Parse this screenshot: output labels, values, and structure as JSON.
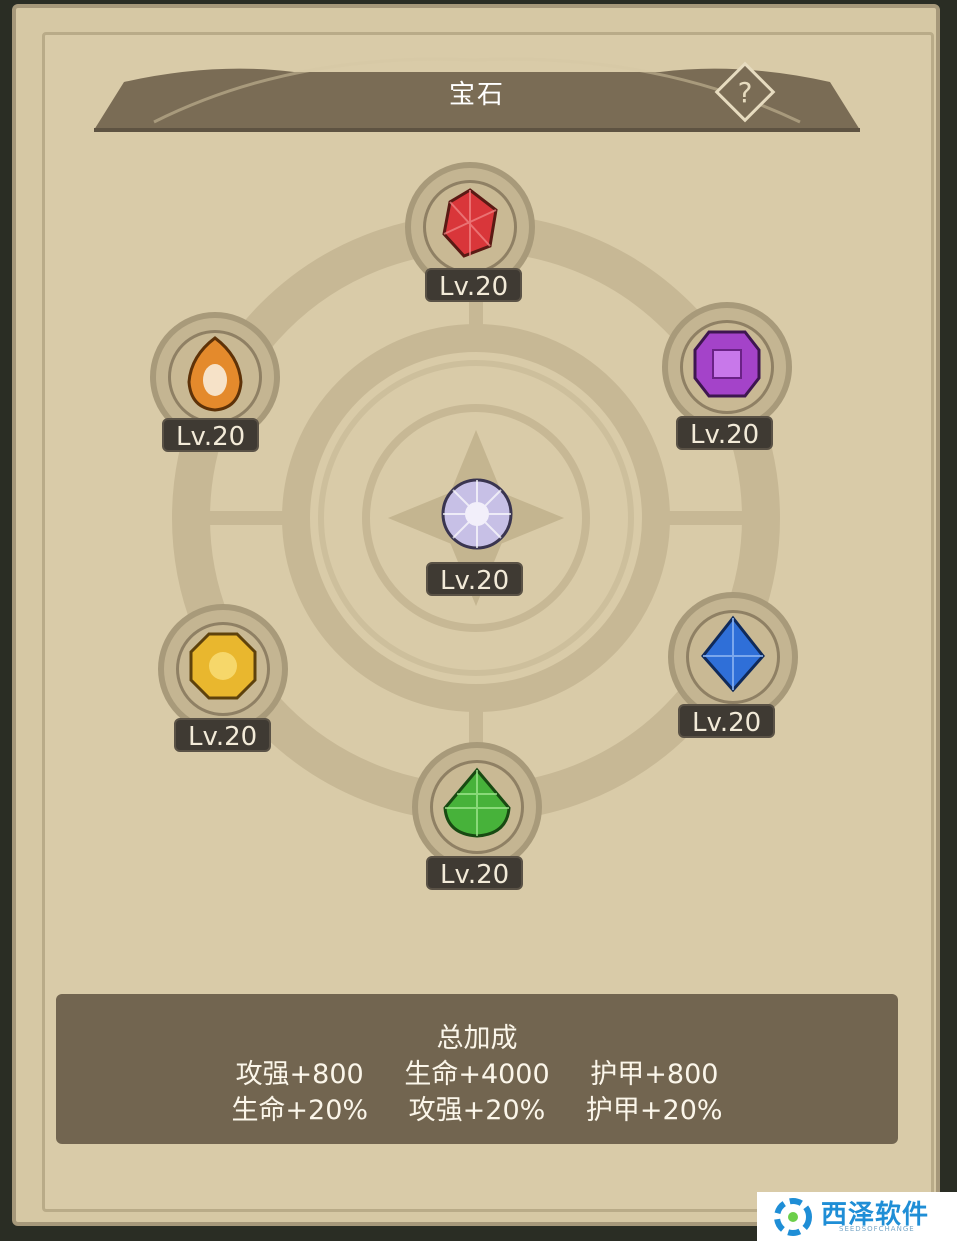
{
  "header": {
    "title": "宝石",
    "help_icon": "question-mark-diamond-icon",
    "help_glyph": "?"
  },
  "gems": [
    {
      "id": "ruby",
      "name": "red-gem",
      "color": "#d9363a",
      "level": "Lv.20"
    },
    {
      "id": "amethyst",
      "name": "purple-gem",
      "color": "#a443c9",
      "level": "Lv.20"
    },
    {
      "id": "sapphire",
      "name": "blue-gem",
      "color": "#2f6fd8",
      "level": "Lv.20"
    },
    {
      "id": "emerald",
      "name": "green-gem",
      "color": "#47b23a",
      "level": "Lv.20"
    },
    {
      "id": "topaz",
      "name": "yellow-gem",
      "color": "#e9b72e",
      "level": "Lv.20"
    },
    {
      "id": "amber",
      "name": "orange-gem",
      "color": "#e48a2c",
      "level": "Lv.20"
    },
    {
      "id": "prism",
      "name": "rainbow-gem",
      "color": "#c7c0e6",
      "level": "Lv.20"
    }
  ],
  "summary": {
    "title": "总加成",
    "row1": [
      "攻强+800",
      "生命+4000",
      "护甲+800"
    ],
    "row2": [
      "生命+20%",
      "攻强+20%",
      "护甲+20%"
    ]
  },
  "watermark": {
    "text": "西泽软件",
    "sub": "SEEDSOFCHANGE"
  }
}
